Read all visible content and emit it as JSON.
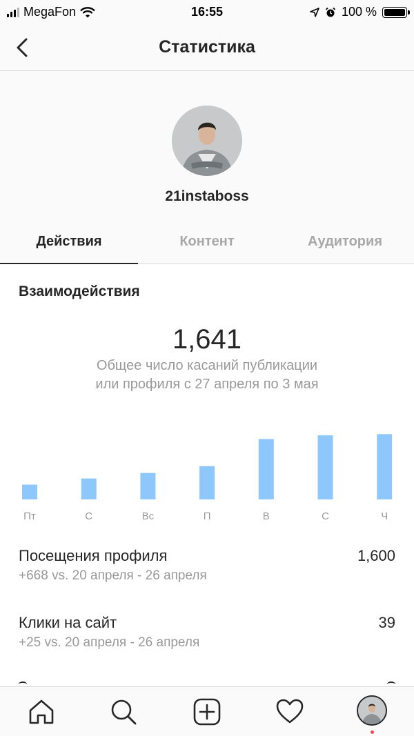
{
  "status_bar": {
    "carrier": "MegaFon",
    "time": "16:55",
    "battery_text": "100 %"
  },
  "header": {
    "title": "Статистика"
  },
  "profile": {
    "username": "21instaboss"
  },
  "tabs": [
    {
      "label": "Действия",
      "active": true
    },
    {
      "label": "Контент",
      "active": false
    },
    {
      "label": "Аудитория",
      "active": false
    }
  ],
  "interactions": {
    "title": "Взаимодействия",
    "total": "1,641",
    "description": "Общее число касаний публикации или профиля с 27 апреля по 3 мая"
  },
  "chart_data": {
    "type": "bar",
    "categories": [
      "Пт",
      "С",
      "Вс",
      "П",
      "В",
      "С",
      "Ч"
    ],
    "values": [
      120,
      170,
      215,
      270,
      490,
      520,
      530
    ],
    "title": "",
    "xlabel": "",
    "ylabel": "",
    "ylim": [
      0,
      560
    ],
    "grid": false,
    "bar_color": "#8ec7fc"
  },
  "metrics": [
    {
      "label": "Посещения профиля",
      "value": "1,600",
      "comparison": "+668 vs. 20 апреля - 26 апреля"
    },
    {
      "label": "Клики на сайт",
      "value": "39",
      "comparison": "+25 vs. 20 апреля - 26 апреля"
    }
  ],
  "tab_bar": {
    "icons": [
      "home-icon",
      "search-icon",
      "add-post-icon",
      "heart-icon",
      "profile-avatar"
    ],
    "notification_color": "#ed4956"
  }
}
